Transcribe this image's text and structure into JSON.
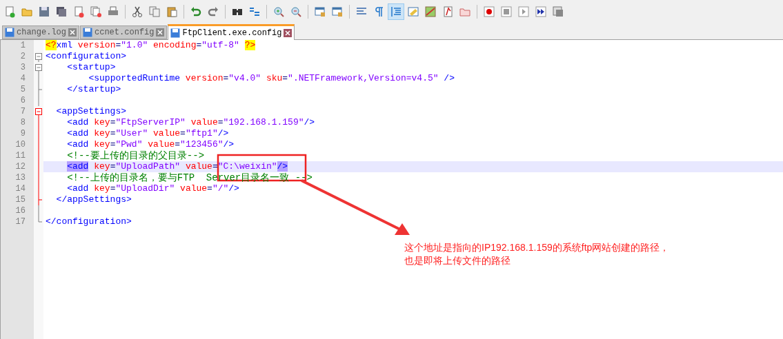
{
  "toolbar": [
    {
      "kind": "new",
      "pressed": false
    },
    {
      "kind": "open",
      "pressed": false
    },
    {
      "kind": "save",
      "pressed": false
    },
    {
      "kind": "save-all",
      "pressed": false
    },
    {
      "kind": "close",
      "pressed": false
    },
    {
      "kind": "close-all",
      "pressed": false
    },
    {
      "kind": "print",
      "pressed": false
    },
    {
      "kind": "sep"
    },
    {
      "kind": "cut",
      "pressed": false
    },
    {
      "kind": "copy",
      "pressed": false
    },
    {
      "kind": "paste",
      "pressed": false
    },
    {
      "kind": "sep"
    },
    {
      "kind": "undo",
      "pressed": false
    },
    {
      "kind": "redo",
      "pressed": false
    },
    {
      "kind": "sep"
    },
    {
      "kind": "find",
      "pressed": false
    },
    {
      "kind": "replace",
      "pressed": false
    },
    {
      "kind": "sep"
    },
    {
      "kind": "zoom-in",
      "pressed": false
    },
    {
      "kind": "zoom-out",
      "pressed": false
    },
    {
      "kind": "sep"
    },
    {
      "kind": "window",
      "pressed": false
    },
    {
      "kind": "window",
      "pressed": false
    },
    {
      "kind": "sep"
    },
    {
      "kind": "wrap",
      "pressed": false
    },
    {
      "kind": "pilcrow",
      "pressed": false
    },
    {
      "kind": "indent",
      "pressed": true
    },
    {
      "kind": "lang",
      "pressed": false
    },
    {
      "kind": "map",
      "pressed": false
    },
    {
      "kind": "doc",
      "pressed": false
    },
    {
      "kind": "folder",
      "pressed": false
    },
    {
      "kind": "sep"
    },
    {
      "kind": "record",
      "pressed": false
    },
    {
      "kind": "stop",
      "pressed": false
    },
    {
      "kind": "play",
      "pressed": false
    },
    {
      "kind": "play-multi",
      "pressed": false
    },
    {
      "kind": "save-macro",
      "pressed": false
    }
  ],
  "tabs": [
    {
      "label": "change.log",
      "selected": false
    },
    {
      "label": "ccnet.config",
      "selected": false
    },
    {
      "label": "FtpClient.exe.config",
      "selected": true
    }
  ],
  "lines": [
    {
      "number": "1",
      "kind": "plain",
      "fold_active": false,
      "current": false,
      "tokens": [
        {
          "kind": "decl",
          "text": "<?"
        },
        {
          "kind": "tag",
          "text": "xml "
        },
        {
          "kind": "attr",
          "text": "version"
        },
        {
          "kind": "plain",
          "text": "="
        },
        {
          "kind": "value",
          "text": "\"1.0\" "
        },
        {
          "kind": "attr",
          "text": "encoding"
        },
        {
          "kind": "plain",
          "text": "="
        },
        {
          "kind": "value",
          "text": "\"utf-8\" "
        },
        {
          "kind": "decl",
          "text": "?>"
        }
      ]
    },
    {
      "number": "2",
      "kind": "fold-start",
      "fold_active": false,
      "current": false,
      "tokens": [
        {
          "kind": "tag",
          "text": "<configuration>"
        }
      ]
    },
    {
      "number": "3",
      "kind": "fold-start",
      "fold_active": false,
      "current": false,
      "tokens": [
        {
          "kind": "tag",
          "text": "    <startup>"
        }
      ]
    },
    {
      "number": "4",
      "kind": "fold-body",
      "fold_active": false,
      "current": false,
      "tokens": [
        {
          "kind": "tag",
          "text": "        <supportedRuntime "
        },
        {
          "kind": "attr",
          "text": "version"
        },
        {
          "kind": "plain",
          "text": "="
        },
        {
          "kind": "value",
          "text": "\"v4.0\" "
        },
        {
          "kind": "attr",
          "text": "sku"
        },
        {
          "kind": "plain",
          "text": "="
        },
        {
          "kind": "value",
          "text": "\".NETFramework,Version=v4.5\" "
        },
        {
          "kind": "tag",
          "text": "/>"
        }
      ]
    },
    {
      "number": "5",
      "kind": "fold-end",
      "fold_active": false,
      "current": false,
      "tokens": [
        {
          "kind": "tag",
          "text": "    </startup>"
        }
      ]
    },
    {
      "number": "6",
      "kind": "fold-body",
      "fold_active": false,
      "current": false
    },
    {
      "number": "7",
      "kind": "fold-start",
      "fold_active": true,
      "current": false,
      "tokens": [
        {
          "kind": "tag",
          "text": "  <appSettings>"
        }
      ]
    },
    {
      "number": "8",
      "kind": "fold-body",
      "fold_active": true,
      "current": false,
      "tokens": [
        {
          "kind": "tag",
          "text": "    <add "
        },
        {
          "kind": "attr",
          "text": "key"
        },
        {
          "kind": "plain",
          "text": "="
        },
        {
          "kind": "value",
          "text": "\"FtpServerIP\" "
        },
        {
          "kind": "attr",
          "text": "value"
        },
        {
          "kind": "plain",
          "text": "="
        },
        {
          "kind": "value",
          "text": "\"192.168.1.159\""
        },
        {
          "kind": "tag",
          "text": "/>"
        }
      ]
    },
    {
      "number": "9",
      "kind": "fold-body",
      "fold_active": true,
      "current": false,
      "tokens": [
        {
          "kind": "tag",
          "text": "    <add "
        },
        {
          "kind": "attr",
          "text": "key"
        },
        {
          "kind": "plain",
          "text": "="
        },
        {
          "kind": "value",
          "text": "\"User\" "
        },
        {
          "kind": "attr",
          "text": "value"
        },
        {
          "kind": "plain",
          "text": "="
        },
        {
          "kind": "value",
          "text": "\"ftp1\""
        },
        {
          "kind": "tag",
          "text": "/>"
        }
      ]
    },
    {
      "number": "10",
      "kind": "fold-body",
      "fold_active": true,
      "current": false,
      "tokens": [
        {
          "kind": "tag",
          "text": "    <add "
        },
        {
          "kind": "attr",
          "text": "key"
        },
        {
          "kind": "plain",
          "text": "="
        },
        {
          "kind": "value",
          "text": "\"Pwd\" "
        },
        {
          "kind": "attr",
          "text": "value"
        },
        {
          "kind": "plain",
          "text": "="
        },
        {
          "kind": "value",
          "text": "\"123456\""
        },
        {
          "kind": "tag",
          "text": "/>"
        }
      ]
    },
    {
      "number": "11",
      "kind": "fold-body",
      "fold_active": true,
      "current": false,
      "tokens": [
        {
          "kind": "comment",
          "text": "    <!--要上传的目录的父目录-->"
        }
      ]
    },
    {
      "number": "12",
      "kind": "fold-body",
      "fold_active": true,
      "current": true,
      "tokens": [
        {
          "kind": "tag-match",
          "text": "    <add"
        },
        {
          "kind": "attr",
          "text": " key"
        },
        {
          "kind": "plain",
          "text": "="
        },
        {
          "kind": "value",
          "text": "\"UploadPath\" "
        },
        {
          "kind": "attr",
          "text": "value"
        },
        {
          "kind": "plain",
          "text": "="
        },
        {
          "kind": "value",
          "text": "\"C:\\weixin\""
        },
        {
          "kind": "tag-match",
          "text": "/>"
        }
      ]
    },
    {
      "number": "13",
      "kind": "fold-body",
      "fold_active": true,
      "current": false,
      "tokens": [
        {
          "kind": "comment",
          "text": "    <!--上传的目录名，要与FTP  Server目录名一致 -->"
        }
      ]
    },
    {
      "number": "14",
      "kind": "fold-body",
      "fold_active": true,
      "current": false,
      "tokens": [
        {
          "kind": "tag",
          "text": "    <add "
        },
        {
          "kind": "attr",
          "text": "key"
        },
        {
          "kind": "plain",
          "text": "="
        },
        {
          "kind": "value",
          "text": "\"UploadDir\" "
        },
        {
          "kind": "attr",
          "text": "value"
        },
        {
          "kind": "plain",
          "text": "="
        },
        {
          "kind": "value",
          "text": "\"/\""
        },
        {
          "kind": "tag",
          "text": "/>"
        }
      ]
    },
    {
      "number": "15",
      "kind": "fold-end",
      "fold_active": true,
      "current": false,
      "tokens": [
        {
          "kind": "tag",
          "text": "  </appSettings>"
        }
      ]
    },
    {
      "number": "16",
      "kind": "fold-body",
      "fold_active": false,
      "current": false
    },
    {
      "number": "17",
      "kind": "fold-last",
      "fold_active": false,
      "current": false,
      "tokens": [
        {
          "kind": "tag",
          "text": "</configuration>"
        }
      ]
    }
  ],
  "annotation": {
    "lines": [
      "这个地址是指向的IP192.168.1.159的系统ftp网站创建的路径，",
      "也是即将上传文件的路径"
    ]
  }
}
